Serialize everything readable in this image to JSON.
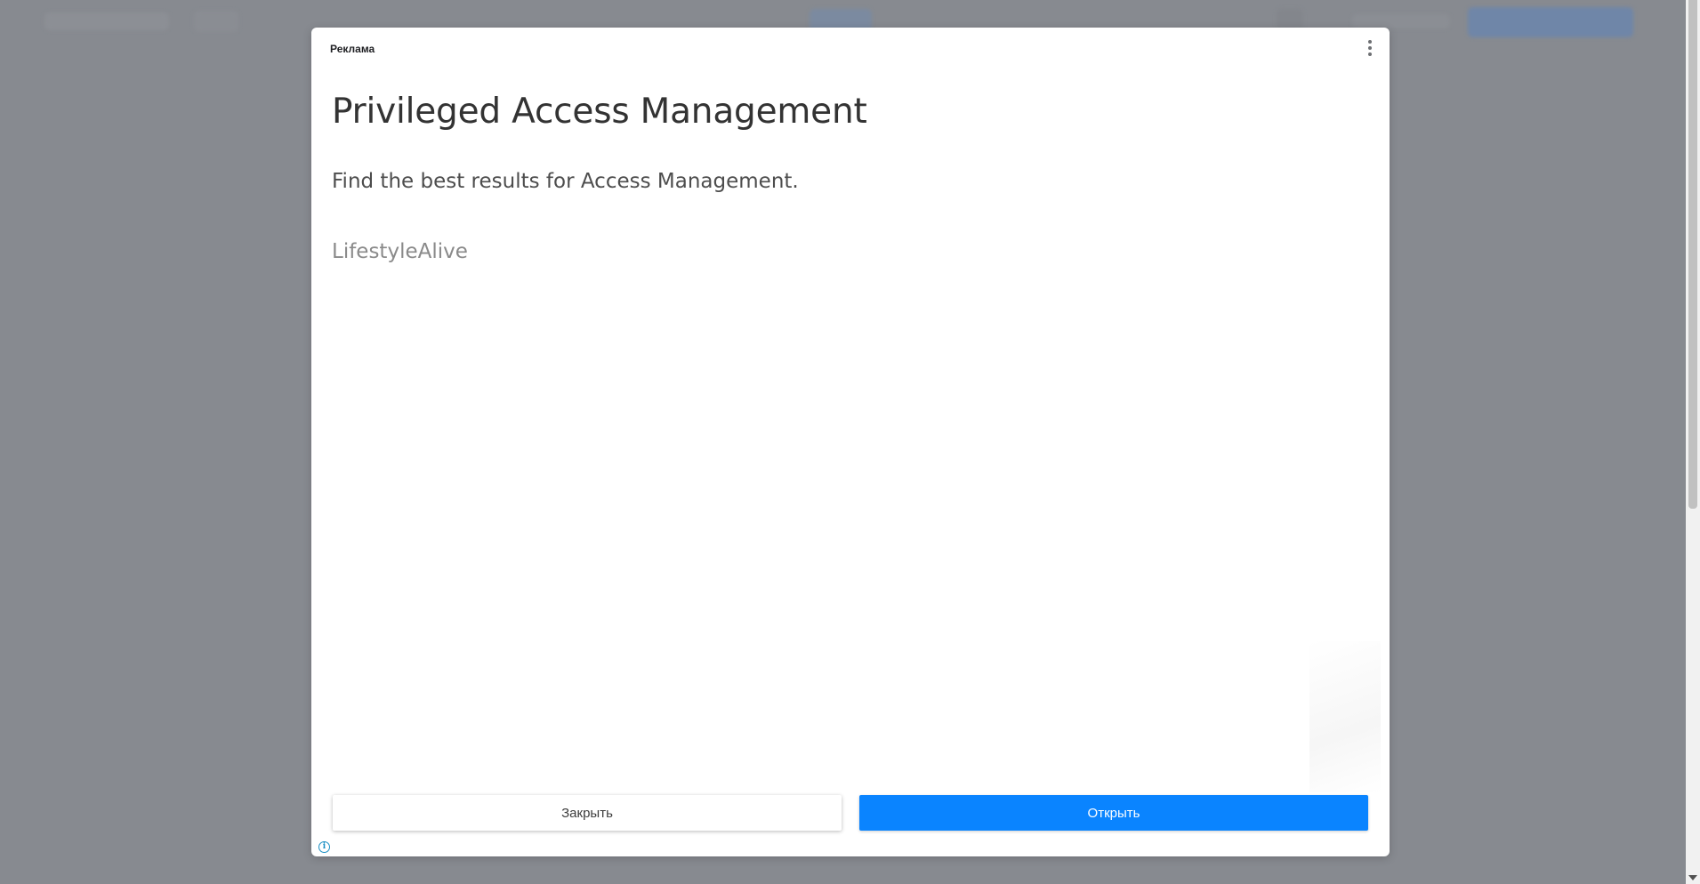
{
  "ad": {
    "label": "Реклама",
    "title": "Privileged Access Management",
    "description": "Find the best results for Access Management.",
    "advertiser": "LifestyleAlive",
    "close_label": "Закрыть",
    "open_label": "Открыть",
    "info_glyph": "i"
  },
  "colors": {
    "open_button": "#0a84ff",
    "overlay": "#878a90",
    "info_icon": "#1a8fc4"
  }
}
